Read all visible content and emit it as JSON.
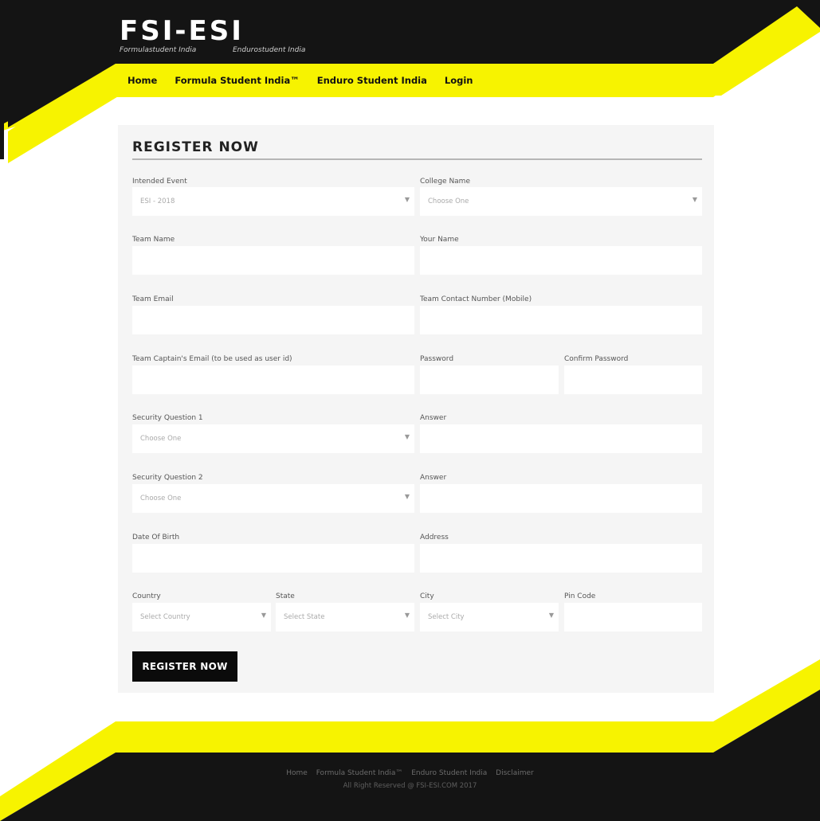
{
  "header": {
    "logo_text": "FSI-ESI",
    "logo_sub_left": "Formulastudent India",
    "logo_sub_right": "Endurostudent India"
  },
  "nav": {
    "home": "Home",
    "fsi": "Formula Student India™",
    "esi": "Enduro Student India",
    "login": "Login"
  },
  "form": {
    "title": "REGISTER NOW",
    "intended_event": {
      "label": "Intended Event",
      "value": "ESI - 2018"
    },
    "college_name": {
      "label": "College Name",
      "placeholder": "Choose One"
    },
    "team_name": {
      "label": "Team Name"
    },
    "your_name": {
      "label": "Your Name"
    },
    "team_email": {
      "label": "Team Email"
    },
    "team_contact": {
      "label": "Team Contact Number (Mobile)"
    },
    "captain_email": {
      "label": "Team Captain's Email (to be used as user id)"
    },
    "password": {
      "label": "Password"
    },
    "confirm_password": {
      "label": "Confirm Password"
    },
    "security_q1": {
      "label": "Security Question 1",
      "placeholder": "Choose One"
    },
    "answer1": {
      "label": "Answer"
    },
    "security_q2": {
      "label": "Security Question 2",
      "placeholder": "Choose One"
    },
    "answer2": {
      "label": "Answer"
    },
    "dob": {
      "label": "Date Of Birth"
    },
    "address": {
      "label": "Address"
    },
    "country": {
      "label": "Country",
      "placeholder": "Select Country"
    },
    "state": {
      "label": "State",
      "placeholder": "Select State"
    },
    "city": {
      "label": "City",
      "placeholder": "Select City"
    },
    "pin": {
      "label": "Pin Code"
    },
    "submit_label": "REGISTER NOW"
  },
  "footer": {
    "links": [
      "Home",
      "Formula Student India™",
      "Enduro Student India",
      "Disclaimer"
    ],
    "copyright": "All Right Reserved @ FSI-ESI.COM 2017"
  },
  "colors": {
    "accent_yellow": "#f7f300",
    "dark": "#141414",
    "card_bg": "#f5f5f5"
  }
}
